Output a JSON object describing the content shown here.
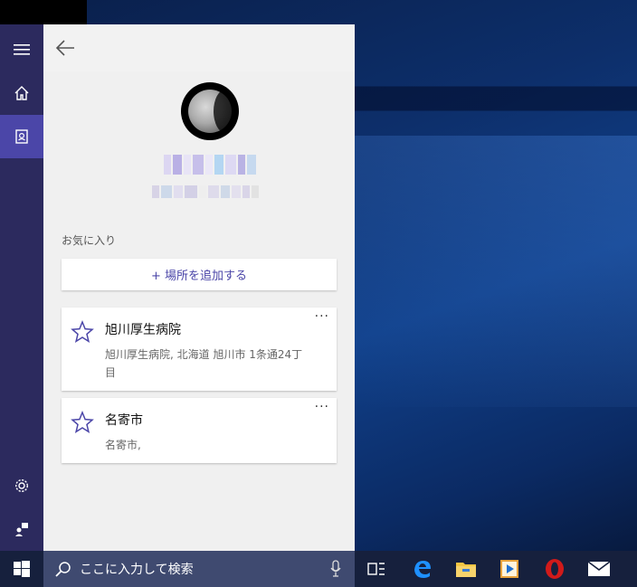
{
  "window": {
    "back_label": "Back"
  },
  "nav": {
    "items": [
      {
        "icon": "hamburger-menu-icon"
      },
      {
        "icon": "home-icon"
      },
      {
        "icon": "notebook-icon",
        "active": true
      },
      {
        "icon": "settings-gear-icon"
      },
      {
        "icon": "feedback-icon"
      }
    ]
  },
  "profile": {
    "avatar": "moon-avatar"
  },
  "favorites": {
    "section_label": "お気に入り",
    "add_button_label": "+  場所を追加する",
    "items": [
      {
        "title": "旭川厚生病院",
        "address": "旭川厚生病院, 北海道 旭川市 1条通24丁目",
        "more": "···"
      },
      {
        "title": "名寄市",
        "address": "名寄市,",
        "more": "···"
      }
    ]
  },
  "taskbar": {
    "search_placeholder": "ここに入力して検索",
    "apps": [
      "task-view-icon",
      "edge-icon",
      "file-explorer-icon",
      "media-player-icon",
      "opera-icon",
      "mail-icon"
    ]
  },
  "colors": {
    "accent": "#4b46a8",
    "rail": "#2c2a5e",
    "taskbar": "#16203d",
    "searchbox": "#3f4a70"
  }
}
